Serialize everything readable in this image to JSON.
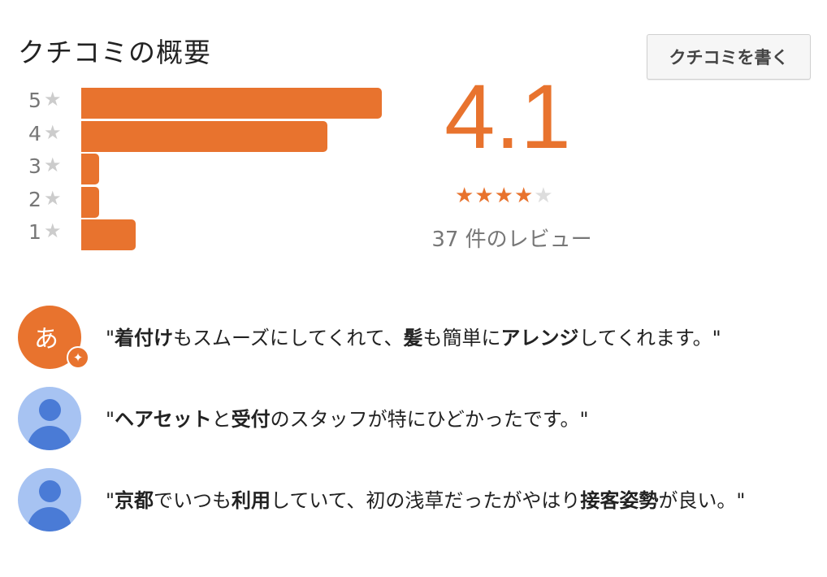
{
  "header": {
    "title": "クチコミの概要",
    "write_review_label": "クチコミを書く"
  },
  "rating_distribution": [
    {
      "stars": "5",
      "fraction": 1.0
    },
    {
      "stars": "4",
      "fraction": 0.82
    },
    {
      "stars": "3",
      "fraction": 0.06
    },
    {
      "stars": "2",
      "fraction": 0.06
    },
    {
      "stars": "1",
      "fraction": 0.18
    }
  ],
  "summary": {
    "score": "4.1",
    "stars_filled": 4,
    "stars_total": 5,
    "review_count_label": "37 件のレビュー"
  },
  "colors": {
    "accent": "#e8732e",
    "avatar_person_bg": "#a7c3f2",
    "avatar_person_fg": "#4a7bd6"
  },
  "snippets": [
    {
      "avatar": {
        "type": "letter",
        "glyph": "あ",
        "badge_icon": "sparkle-icon"
      },
      "parts": [
        {
          "t": "\"",
          "b": false
        },
        {
          "t": "着付け",
          "b": true
        },
        {
          "t": "もスムーズにしてくれて、",
          "b": false
        },
        {
          "t": "髪",
          "b": true
        },
        {
          "t": "も簡単に",
          "b": false
        },
        {
          "t": "アレンジ",
          "b": true
        },
        {
          "t": "してくれます。\"",
          "b": false
        }
      ]
    },
    {
      "avatar": {
        "type": "person",
        "icon": "default-profile-icon"
      },
      "parts": [
        {
          "t": "\"",
          "b": false
        },
        {
          "t": "ヘアセット",
          "b": true
        },
        {
          "t": "と",
          "b": false
        },
        {
          "t": "受付",
          "b": true
        },
        {
          "t": "のスタッフが特にひどかったです。\"",
          "b": false
        }
      ]
    },
    {
      "avatar": {
        "type": "person",
        "icon": "default-profile-icon"
      },
      "parts": [
        {
          "t": "\"",
          "b": false
        },
        {
          "t": "京都",
          "b": true
        },
        {
          "t": "でいつも",
          "b": false
        },
        {
          "t": "利用",
          "b": true
        },
        {
          "t": "していて、初の浅草だったがやはり",
          "b": false
        },
        {
          "t": "接客姿勢",
          "b": true
        },
        {
          "t": "が良い。\"",
          "b": false
        }
      ]
    }
  ]
}
